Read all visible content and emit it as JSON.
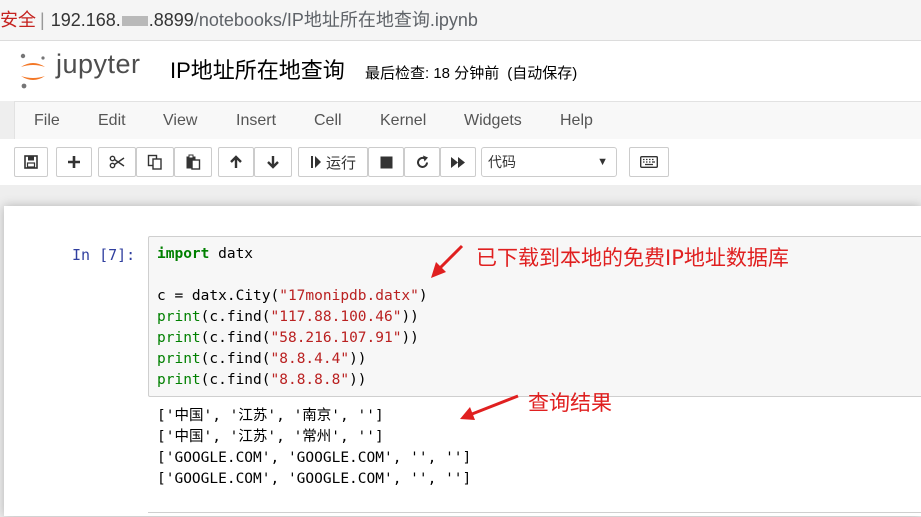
{
  "address_bar": {
    "security_label": "安全",
    "separator": "|",
    "host_prefix": "192.168.",
    "host_suffix": ".8899",
    "path": "/notebooks/IP地址所在地查询.ipynb"
  },
  "header": {
    "logo_text": "jupyter",
    "notebook_title": "IP地址所在地查询",
    "checkpoint_label": "最后检查: 18 分钟前",
    "autosave_label": "(自动保存)"
  },
  "menu": {
    "items": [
      "File",
      "Edit",
      "View",
      "Insert",
      "Cell",
      "Kernel",
      "Widgets",
      "Help"
    ]
  },
  "toolbar": {
    "run_label": "运行",
    "cell_type": "代码",
    "icons": [
      "save-icon",
      "plus-icon",
      "scissors-icon",
      "copy-icon",
      "paste-icon",
      "arrow-up-icon",
      "arrow-down-icon",
      "run-icon",
      "stop-icon",
      "restart-icon",
      "fast-forward-icon",
      "keyboard-icon"
    ]
  },
  "cell": {
    "prompt": "In  [7]:",
    "code": {
      "line1_kw": "import",
      "line1_rest": " datx",
      "line2": "",
      "line3_pre": "c = datx.City(",
      "line3_str": "\"17monipdb.datx\"",
      "line3_post": ")",
      "find_calls": [
        {
          "fn": "print",
          "mid": "(c.find(",
          "arg": "\"117.88.100.46\"",
          "end": "))"
        },
        {
          "fn": "print",
          "mid": "(c.find(",
          "arg": "\"58.216.107.91\"",
          "end": "))"
        },
        {
          "fn": "print",
          "mid": "(c.find(",
          "arg": "\"8.8.4.4\"",
          "end": "))"
        },
        {
          "fn": "print",
          "mid": "(c.find(",
          "arg": "\"8.8.8.8\"",
          "end": "))"
        }
      ]
    },
    "output_lines": [
      "['中国', '江苏', '南京', '']",
      "['中国', '江苏', '常州', '']",
      "['GOOGLE.COM', 'GOOGLE.COM', '', '']",
      "['GOOGLE.COM', 'GOOGLE.COM', '', '']"
    ]
  },
  "annotations": {
    "database_note": "已下载到本地的免费IP地址数据库",
    "result_note": "查询结果",
    "color": "#e02020"
  },
  "colors": {
    "keyword": "#008000",
    "string": "#ba2121",
    "prompt": "#303f9f",
    "logo_orange": "#f37726"
  }
}
